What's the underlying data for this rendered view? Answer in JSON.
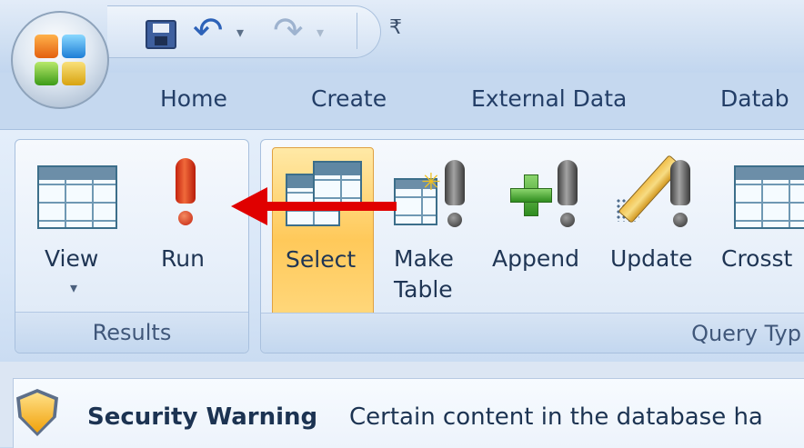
{
  "quick_access": {
    "undo_caret": "▾",
    "redo_caret": "▾",
    "customize_glyph": "₹"
  },
  "tabs": [
    {
      "label": "Home"
    },
    {
      "label": "Create"
    },
    {
      "label": "External Data"
    },
    {
      "label": "Datab"
    }
  ],
  "ribbon": {
    "results_group": {
      "label": "Results",
      "view_label": "View",
      "view_caret": "▾",
      "run_label": "Run"
    },
    "query_type_group": {
      "label": "Query Typ",
      "select_label": "Select",
      "make_table_label_line1": "Make",
      "make_table_label_line2": "Table",
      "append_label": "Append",
      "update_label": "Update",
      "crosstab_label": "Crosst"
    }
  },
  "security_bar": {
    "title": "Security Warning",
    "message": "Certain content in the database ha"
  },
  "colors": {
    "arrow": "#e00000",
    "select_highlight": "#ffc95a",
    "run_icon": "#d02a12"
  },
  "icons": {
    "office_button": "office-logo-icon",
    "save": "floppy-disk-icon",
    "undo": "undo-arrow-icon",
    "redo": "redo-arrow-icon",
    "view": "table-grid-icon",
    "run": "exclamation-icon",
    "select": "select-query-icon",
    "make_table": "make-table-query-icon",
    "append": "append-query-icon",
    "update": "update-query-icon",
    "crosstab": "crosstab-query-icon",
    "security": "shield-icon"
  }
}
